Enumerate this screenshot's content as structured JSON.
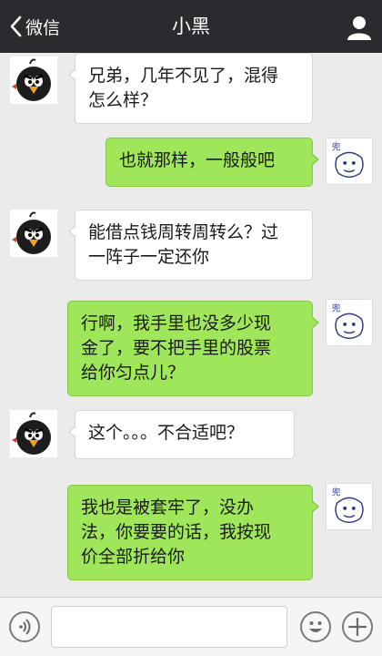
{
  "header": {
    "back_label": "微信",
    "title": "小黑"
  },
  "messages": [
    {
      "side": "left",
      "text": "兄弟，几年不见了，混得\n怎么样？"
    },
    {
      "side": "right",
      "text": "也就那样，一般般吧"
    },
    {
      "side": "left",
      "text": "能借点钱周转周转么？过\n一阵子一定还你"
    },
    {
      "side": "right",
      "text": "行啊，我手里也没多少现\n金了，要不把手里的股票\n给你匀点儿？"
    },
    {
      "side": "left",
      "text": "这个。。。不合适吧？"
    },
    {
      "side": "right",
      "text": "我也是被套牢了，没办\n法，你要要的话，我按现\n价全部折给你"
    }
  ],
  "avatar_label": "兜",
  "input": {
    "value": "",
    "placeholder": ""
  },
  "colors": {
    "topbar": "#2b2b2f",
    "background": "#ebebeb",
    "sent_bubble": "#9fe65a",
    "received_bubble": "#ffffff"
  }
}
